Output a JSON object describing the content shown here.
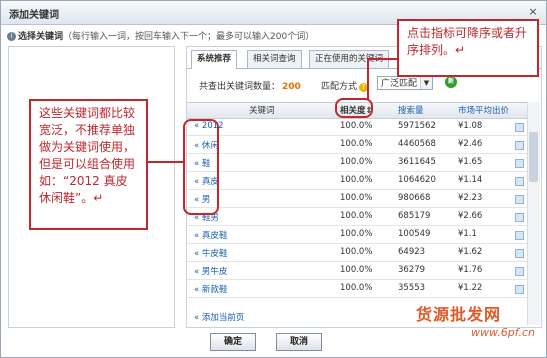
{
  "dialog": {
    "title": "添加关键词",
    "close_glyph": "×",
    "hint_icon": "info-icon",
    "hint_label": "选择关键词",
    "hint_sub": "（每行输入一词，按回车输入下一个；最多可以输入200个词）"
  },
  "tabs": [
    {
      "label": "系统推荐",
      "active": true
    },
    {
      "label": "相关词查询",
      "active": false
    },
    {
      "label": "正在使用的关键词",
      "active": false
    }
  ],
  "summary": {
    "label": "共查出关键词数量：",
    "count": "200"
  },
  "match": {
    "label": "匹配方式",
    "help_icon": "question-icon",
    "help_glyph": "?",
    "value": "广泛匹配",
    "new_badge": "新"
  },
  "table": {
    "headers": {
      "keyword": "关键词",
      "relevance": "相关度⇕",
      "search": "搜索量",
      "price": "市场平均出价"
    },
    "rows": [
      {
        "kw": "2012",
        "rel": "100.0%",
        "sv": "5971562",
        "pr": "¥1.08"
      },
      {
        "kw": "休闲",
        "rel": "100.0%",
        "sv": "4460568",
        "pr": "¥2.46"
      },
      {
        "kw": "鞋",
        "rel": "100.0%",
        "sv": "3611645",
        "pr": "¥1.65"
      },
      {
        "kw": "真皮",
        "rel": "100.0%",
        "sv": "1064620",
        "pr": "¥1.14"
      },
      {
        "kw": "男",
        "rel": "100.0%",
        "sv": "980668",
        "pr": "¥2.23"
      },
      {
        "kw": "鞋男",
        "rel": "100.0%",
        "sv": "685179",
        "pr": "¥2.66"
      },
      {
        "kw": "真皮鞋",
        "rel": "100.0%",
        "sv": "100549",
        "pr": "¥1.1"
      },
      {
        "kw": "牛皮鞋",
        "rel": "100.0%",
        "sv": "64923",
        "pr": "¥1.62"
      },
      {
        "kw": "男牛皮",
        "rel": "100.0%",
        "sv": "36279",
        "pr": "¥1.76"
      },
      {
        "kw": "新款鞋",
        "rel": "100.0%",
        "sv": "35553",
        "pr": "¥1.22"
      }
    ],
    "add_all": "添加当前页"
  },
  "buttons": {
    "ok": "确定",
    "cancel": "取消"
  },
  "annotations": {
    "left": "这些关键词都比较宽泛，不推荐单独做为关键词使用，但是可以组合使用如：“2012 真皮休闲鞋”。↵",
    "right": "点击指标可降序或者升序排列。↵"
  },
  "watermark": {
    "text": "货源批发网",
    "url": "www.6pf.cn"
  },
  "colors": {
    "annotation": "#c1272d",
    "link": "#1a5fb4",
    "count": "#e07000"
  }
}
